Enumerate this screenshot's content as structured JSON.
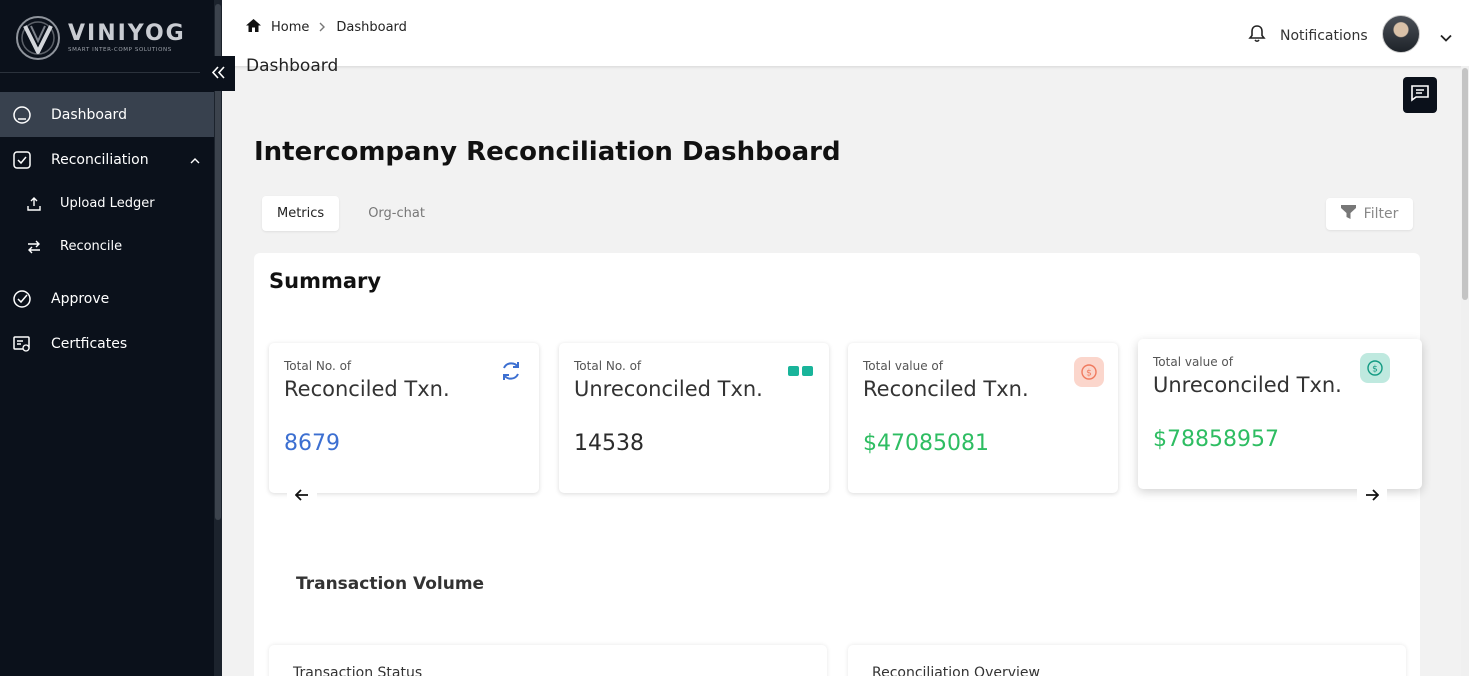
{
  "brand": {
    "name": "VINIYOG",
    "tagline": "SMART INTER-COMP SOLUTIONS"
  },
  "sidebar": {
    "items": [
      {
        "label": "Dashboard",
        "icon": "home-icon",
        "active": true
      },
      {
        "label": "Reconciliation",
        "icon": "check-square-icon",
        "expanded": true
      },
      {
        "label": "Upload Ledger",
        "icon": "upload-icon",
        "sub": true
      },
      {
        "label": "Reconcile",
        "icon": "swap-icon",
        "sub": true
      },
      {
        "label": "Approve",
        "icon": "check-circle-icon"
      },
      {
        "label": "Certficates",
        "icon": "certificate-icon"
      }
    ]
  },
  "header": {
    "breadcrumb_home": "Home",
    "breadcrumb_current": "Dashboard",
    "page_title": "Dashboard",
    "notifications_label": "Notifications"
  },
  "main": {
    "title": "Intercompany Reconciliation Dashboard",
    "tabs": [
      {
        "label": "Metrics",
        "active": true
      },
      {
        "label": "Org-chat"
      }
    ],
    "filter_label": "Filter",
    "summary_title": "Summary",
    "cards": [
      {
        "small": "Total No. of",
        "big": "Reconciled Txn.",
        "value": "8679",
        "value_color": "#3c6fd1",
        "icon": "refresh-icon"
      },
      {
        "small": "Total No. of",
        "big": "Unreconciled Txn.",
        "value": "14538",
        "value_color": "#2b2b2b",
        "icon": "toggle-blocks-icon"
      },
      {
        "small": "Total value of",
        "big": "Reconciled Txn.",
        "value": "$47085081",
        "value_color": "#2ebd62",
        "icon": "dollar-coin-icon"
      },
      {
        "small": "Total value of",
        "big": "Unreconciled Txn.",
        "value": "$78858957",
        "value_color": "#2ebd62",
        "icon": "dollar-coin-icon"
      }
    ],
    "transaction_volume_title": "Transaction Volume",
    "sub_cards": [
      "Transaction Status",
      "Reconciliation Overview"
    ]
  },
  "colors": {
    "sidebar_bg": "#0b111b",
    "active_item_bg": "#38414e",
    "accent_blue": "#3c6fd1",
    "accent_green": "#2ebd62",
    "teal": "#19b49a",
    "salmon": "#f4a08c"
  }
}
